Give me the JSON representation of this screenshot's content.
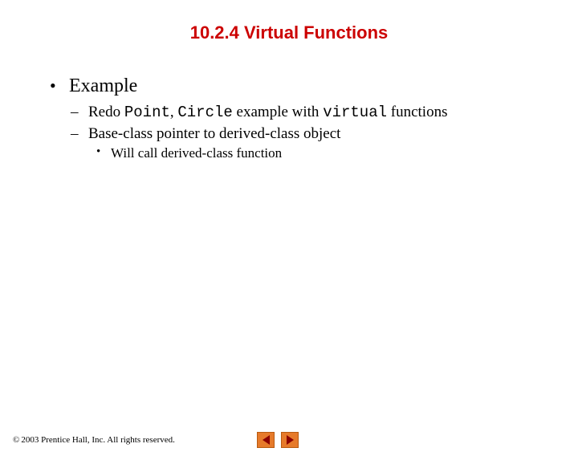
{
  "title": "10.2.4 Virtual Functions",
  "bullets": {
    "l1": "Example",
    "l2a_parts": [
      "Redo ",
      "Point",
      ", ",
      "Circle",
      " example with ",
      "virtual",
      " functions"
    ],
    "l2b": "Base-class pointer to derived-class object",
    "l3": "Will call derived-class function"
  },
  "footer": {
    "copyright": "©",
    "text": " 2003 Prentice Hall, Inc.  All rights reserved."
  }
}
